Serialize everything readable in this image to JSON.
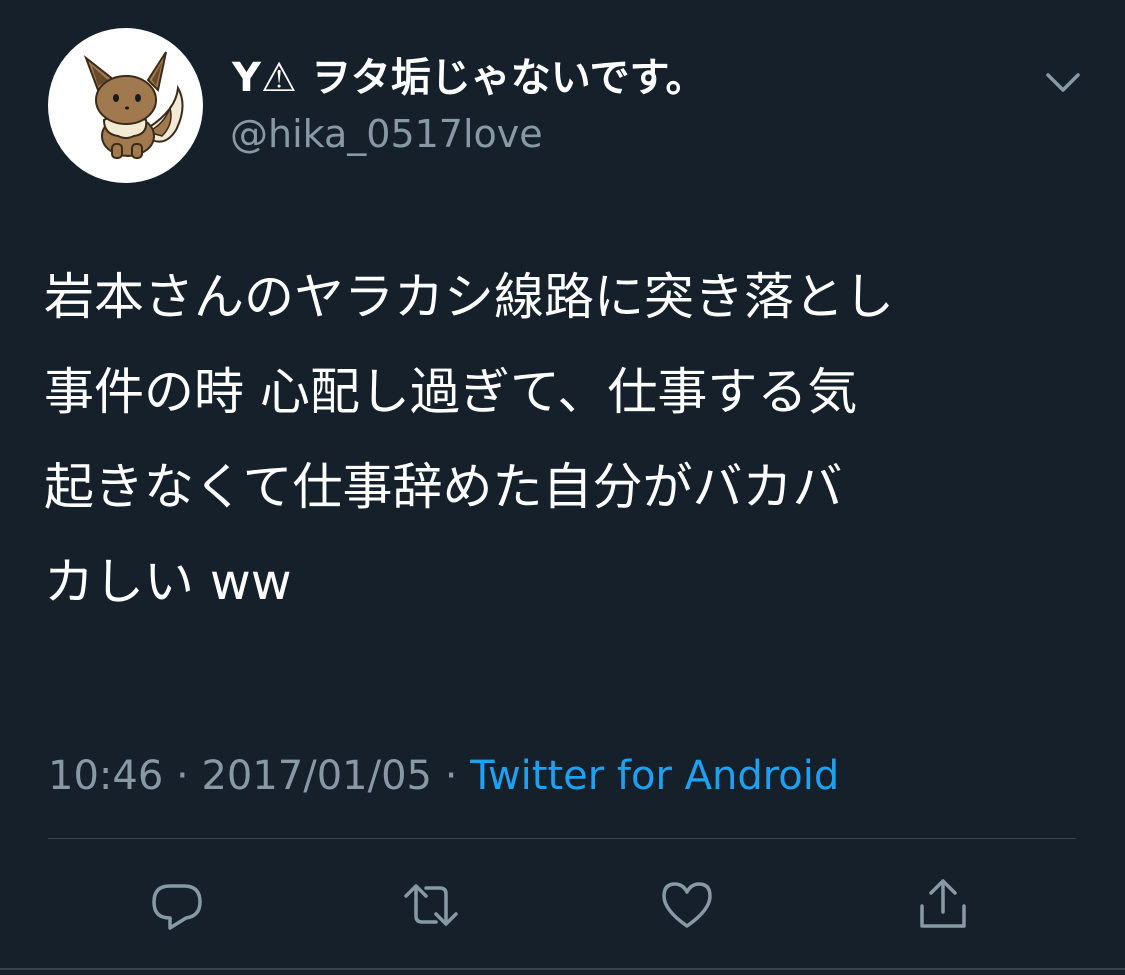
{
  "user": {
    "display_name": "Y⚠ ヲタ垢じゃないです。",
    "handle": "@hika_0517love",
    "avatar_icon": "eevee-avatar"
  },
  "tweet": {
    "text": "岩本さんのヤラカシ線路に突き落とし\n事件の時 心配し過ぎて、仕事する気\n起きなくて仕事辞めた自分がバカバ\nカしい ww",
    "time": "10:46",
    "date": "2017/01/05",
    "separator": " · ",
    "source": "Twitter for Android"
  },
  "actions": {
    "reply_icon": "reply-icon",
    "retweet_icon": "retweet-icon",
    "like_icon": "heart-icon",
    "share_icon": "share-icon"
  },
  "colors": {
    "background": "#15202b",
    "secondary_text": "#8899a6",
    "link": "#1da1f2",
    "divider": "#38444d"
  }
}
